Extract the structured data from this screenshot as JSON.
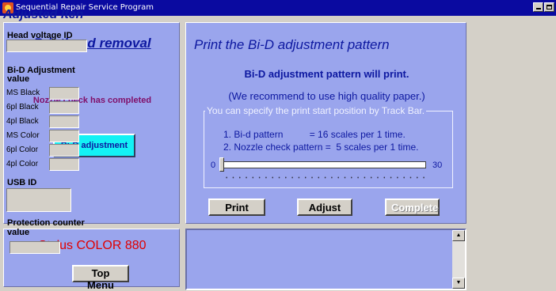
{
  "window": {
    "title": "Sequential Repair Service Program"
  },
  "left_panel": {
    "heading": "Printhead removal",
    "status": "Nozzle check has completed",
    "bid_button": "Bi-D adjustment"
  },
  "center_panel": {
    "title": "Print the Bi-D adjustment pattern",
    "subtitle": "Bi-D adjustment pattern will print.",
    "recommend": "(We recommend to use high quality paper.)",
    "group_label": "You can specify the print start position by Track Bar.",
    "line1": "1. Bi-d pattern          = 16 scales per 1 time.",
    "line2": "2. Nozzle check pattern =  5 scales per 1 time.",
    "track": {
      "min": "0",
      "max": "30",
      "value": 0
    },
    "buttons": {
      "print": "Print",
      "adjust": "Adjust",
      "complete": "Complete"
    }
  },
  "left_bottom": {
    "model": "Stylus COLOR 880",
    "top_menu": "Top Menu"
  },
  "right_panel": {
    "title": "Adjusted Iten",
    "head_voltage_label": "Head voltage ID",
    "head_voltage_value": "",
    "bid_label": "Bi-D Adjustment value",
    "bid_rows": [
      "MS Black",
      "6pl Black",
      "4pl Black",
      "MS Color",
      "6pl Color",
      "4pl Color"
    ],
    "usb_label": "USB ID",
    "usb_value": "",
    "protection_label": "Protection counter value",
    "protection_value": ""
  },
  "colors": {
    "title_bar": "#0a0aa0",
    "panel_bg": "#9aa5ed",
    "heading_text": "#0d18a0",
    "status_text": "#80106a",
    "accent_button": "#13f1f5",
    "model_text": "#e00000"
  }
}
